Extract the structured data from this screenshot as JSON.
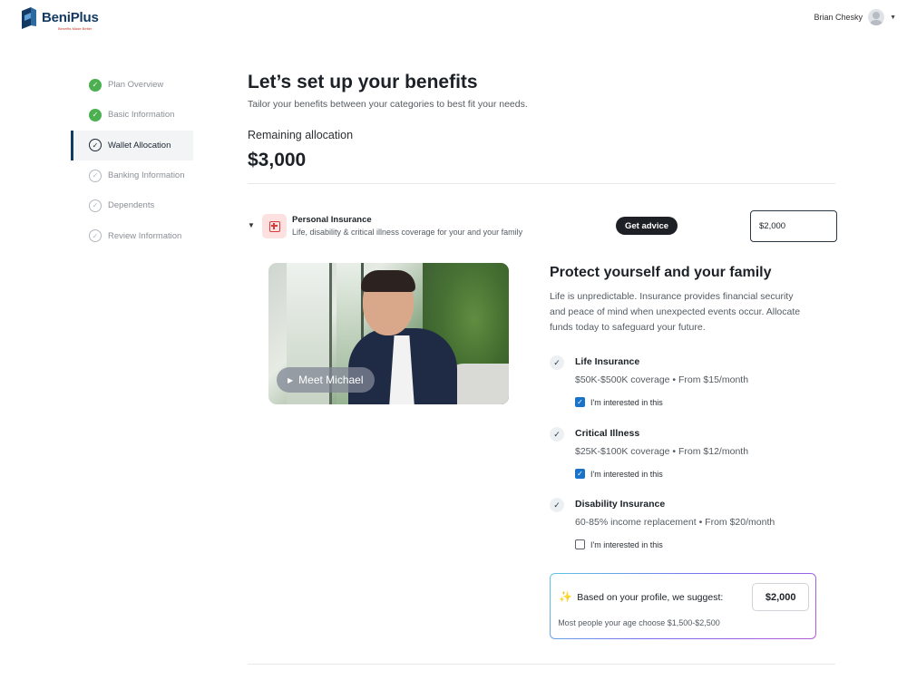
{
  "header": {
    "brand": "BeniPlus",
    "tagline": "Benefits Made Better",
    "user_name": "Brian Chesky",
    "brand_color": "#143a63"
  },
  "sidebar": {
    "steps": [
      {
        "label": "Plan Overview",
        "state": "done"
      },
      {
        "label": "Basic Information",
        "state": "done"
      },
      {
        "label": "Wallet Allocation",
        "state": "current"
      },
      {
        "label": "Banking Information",
        "state": "todo"
      },
      {
        "label": "Dependents",
        "state": "todo"
      },
      {
        "label": "Review Information",
        "state": "todo"
      }
    ]
  },
  "main": {
    "title": "Let’s set up your benefits",
    "subtitle": "Tailor your benefits between your categories to best fit your needs.",
    "remaining_label": "Remaining allocation",
    "remaining_value": "$3,000",
    "category": {
      "name": "Personal Insurance",
      "description": "Life, disability & critical illness coverage for your and your family",
      "advice_label": "Get advice",
      "amount_value": "$2,000"
    },
    "video": {
      "label": "Meet Michael"
    },
    "info": {
      "title": "Protect yourself and your family",
      "text": "Life is unpredictable. Insurance provides financial security and peace of mind when unexpected events occur. Allocate funds today to safeguard your future."
    },
    "benefits": [
      {
        "name": "Life Insurance",
        "desc": "$50K-$500K coverage • From $15/month",
        "interest_label": "I'm interested in this",
        "checked": true
      },
      {
        "name": "Critical Illness",
        "desc": "$25K-$100K coverage • From $12/month",
        "interest_label": "I'm interested in this",
        "checked": true
      },
      {
        "name": "Disability Insurance",
        "desc": "60-85% income replacement • From $20/month",
        "interest_label": "I'm interested in this",
        "checked": false
      }
    ],
    "suggestion": {
      "text": "Based on your profile, we suggest:",
      "amount": "$2,000",
      "note": "Most people your age choose $1,500-$2,500"
    }
  }
}
